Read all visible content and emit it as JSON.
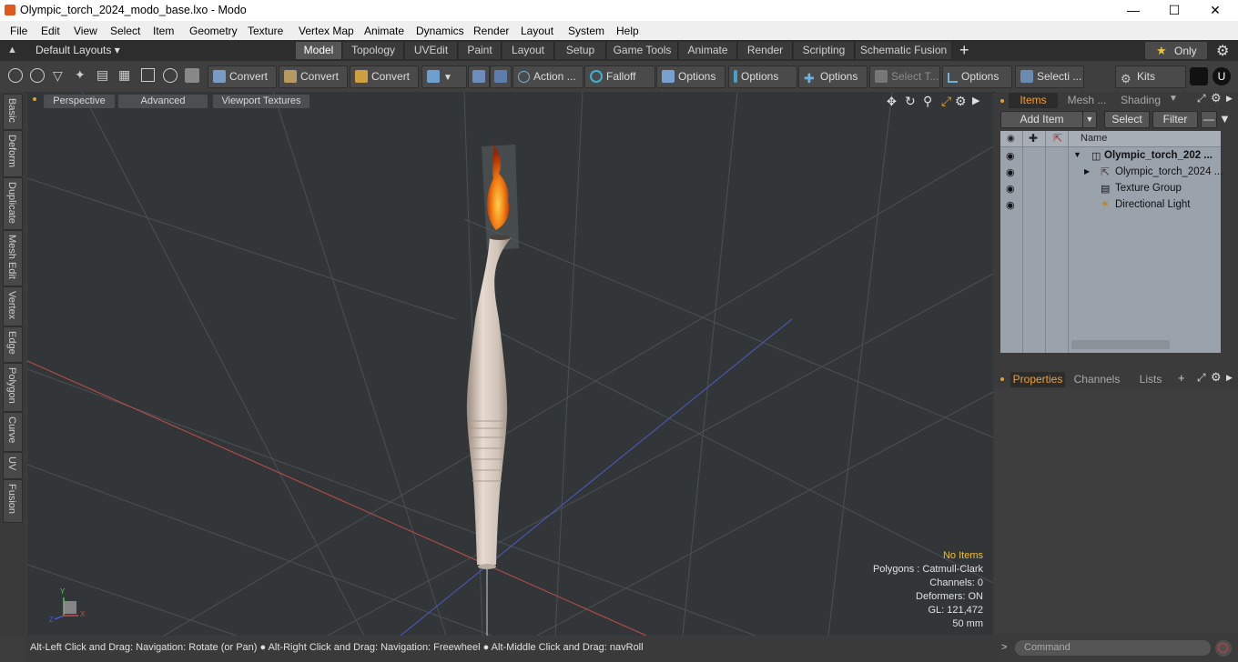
{
  "window": {
    "title": "Olympic_torch_2024_modo_base.lxo - Modo",
    "minimize": "—",
    "maximize": "☐",
    "close": "✕"
  },
  "menu": [
    "File",
    "Edit",
    "View",
    "Select",
    "Item",
    "Geometry",
    "Texture",
    "Vertex Map",
    "Animate",
    "Dynamics",
    "Render",
    "Layout",
    "System",
    "Help"
  ],
  "layout": {
    "preset": "Default Layouts ▾",
    "tabs": [
      "Model",
      "Topology",
      "UVEdit",
      "Paint",
      "Layout",
      "Setup",
      "Game Tools",
      "Animate",
      "Render",
      "Scripting",
      "Schematic Fusion"
    ],
    "active_tab": "Model",
    "add": "+",
    "only": "Only",
    "star": "★"
  },
  "toolbar": {
    "convert1": "Convert",
    "convert2": "Convert",
    "convert3": "Convert",
    "action": "Action",
    "action_more": "...",
    "falloff": "Falloff",
    "options1": "Options",
    "options2": "Options",
    "options3": "Options",
    "options4": "Options",
    "select_t": "Select T...",
    "selecti": "Selecti ...",
    "kits": "Kits"
  },
  "left_tabs": [
    "Basic",
    "Deform",
    "Duplicate",
    "Mesh Edit",
    "Vertex",
    "Edge",
    "Polygon",
    "Curve",
    "UV",
    "Fusion"
  ],
  "viewport": {
    "perspective": "Perspective",
    "advanced": "Advanced",
    "textures": "Viewport Textures",
    "info": {
      "no_items": "No Items",
      "polygons": "Polygons : Catmull-Clark",
      "channels": "Channels: 0",
      "deformers": "Deformers: ON",
      "gl": "GL: 121,472",
      "scale": "50 mm"
    },
    "axis_labels": {
      "y": "Y",
      "x": "X",
      "z": "Z"
    }
  },
  "status": {
    "text": "Alt-Left Click and Drag: Navigation: Rotate (or Pan) ● Alt-Right Click and Drag: Navigation: Freewheel ● Alt-Middle Click and Drag: navRoll"
  },
  "right_panel": {
    "tabs": [
      "Items",
      "Mesh ...",
      "Shading"
    ],
    "add_item": "Add Item",
    "select": "Select",
    "filter": "Filter",
    "column_name": "Name",
    "items": [
      {
        "label": "Olympic_torch_202 ...",
        "bold": true,
        "icon": "scene-icon"
      },
      {
        "label": "Olympic_torch_2024 ...",
        "bold": false,
        "icon": "mesh-icon"
      },
      {
        "label": "Texture Group",
        "bold": false,
        "icon": "texture-group-icon"
      },
      {
        "label": "Directional Light",
        "bold": false,
        "icon": "light-icon"
      }
    ],
    "prop_tabs": [
      "Properties",
      "Channels",
      "Lists"
    ],
    "prop_add": "+",
    "command_placeholder": "Command"
  },
  "colors": {
    "accent": "#f0a030",
    "viewport_bg": "#323638",
    "axis_x": "#c84b4b",
    "axis_z": "#4b5bc8"
  }
}
